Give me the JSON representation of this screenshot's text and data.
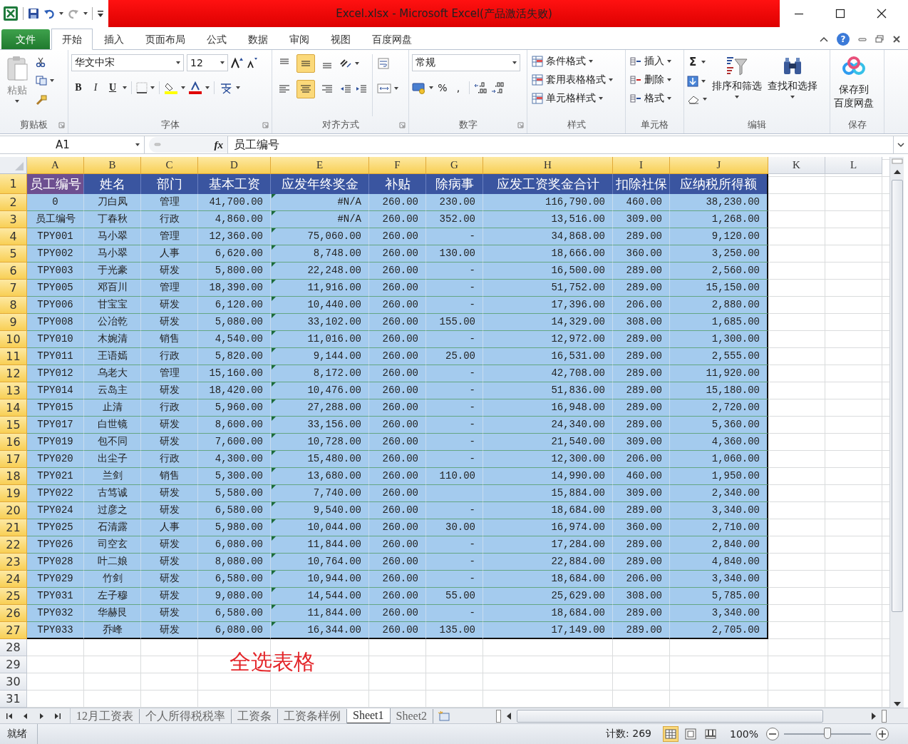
{
  "title_bar": {
    "title": "Excel.xlsx - Microsoft Excel(产品激活失败)"
  },
  "ribbon_tabs": [
    {
      "label": "文件",
      "kind": "file",
      "selected": false
    },
    {
      "label": "开始",
      "kind": "tab",
      "selected": true
    },
    {
      "label": "插入",
      "kind": "tab",
      "selected": false
    },
    {
      "label": "页面布局",
      "kind": "tab",
      "selected": false
    },
    {
      "label": "公式",
      "kind": "tab",
      "selected": false
    },
    {
      "label": "数据",
      "kind": "tab",
      "selected": false
    },
    {
      "label": "审阅",
      "kind": "tab",
      "selected": false
    },
    {
      "label": "视图",
      "kind": "tab",
      "selected": false
    },
    {
      "label": "百度网盘",
      "kind": "tab",
      "selected": false
    }
  ],
  "ribbon": {
    "clipboard": {
      "label": "剪贴板",
      "paste": "粘贴"
    },
    "font": {
      "label": "字体",
      "font_name": "华文中宋",
      "font_size": "12",
      "bold": "B",
      "italic": "I",
      "underline": "U"
    },
    "alignment": {
      "label": "对齐方式",
      "vertical": [
        {
          "selected": false
        },
        {
          "selected": true
        },
        {
          "selected": false
        }
      ],
      "horizontal": [
        {
          "selected": false
        },
        {
          "selected": true
        },
        {
          "selected": false
        }
      ]
    },
    "number": {
      "label": "数字",
      "format": "常规",
      "percent": "%",
      "comma": ","
    },
    "styles": {
      "label": "样式",
      "items": [
        "条件格式",
        "套用表格格式",
        "单元格样式"
      ]
    },
    "cells": {
      "label": "单元格",
      "items": [
        "插入",
        "删除",
        "格式"
      ]
    },
    "editing": {
      "label": "编辑",
      "sum": "Σ",
      "items": [
        "排序和筛选",
        "查找和选择"
      ]
    },
    "save": {
      "label": "保存",
      "button_lines": [
        "保存到",
        "百度网盘"
      ]
    }
  },
  "help": "?",
  "formula_bar": {
    "name_box": "A1",
    "function_label": "fx",
    "content": "员工编号"
  },
  "sheet": {
    "columns": [
      {
        "letter": "A",
        "selected": true
      },
      {
        "letter": "B",
        "selected": true
      },
      {
        "letter": "C",
        "selected": true
      },
      {
        "letter": "D",
        "selected": true
      },
      {
        "letter": "E",
        "selected": true
      },
      {
        "letter": "F",
        "selected": true
      },
      {
        "letter": "G",
        "selected": true
      },
      {
        "letter": "H",
        "selected": true
      },
      {
        "letter": "I",
        "selected": true
      },
      {
        "letter": "J",
        "selected": true
      },
      {
        "letter": "K",
        "selected": false
      },
      {
        "letter": "L",
        "selected": false
      }
    ],
    "rows": [
      {
        "number": "1",
        "selected": true,
        "kind": "header",
        "cells": [
          {
            "text": "员工编号",
            "active": true
          },
          {
            "text": "姓名",
            "active": false
          },
          {
            "text": "部门",
            "active": false
          },
          {
            "text": "基本工资",
            "active": false
          },
          {
            "text": "应发年终奖金",
            "active": false
          },
          {
            "text": "补贴",
            "active": false
          },
          {
            "text": "除病事",
            "active": false
          },
          {
            "text": "应发工资奖金合计",
            "active": false
          },
          {
            "text": "扣除社保",
            "active": false
          },
          {
            "text": "应纳税所得额",
            "active": false
          }
        ]
      },
      {
        "number": "2",
        "selected": true,
        "kind": "data",
        "error_indicator": true,
        "cells": [
          "0",
          "刀白凤",
          "管理",
          "41,700.00",
          "#N/A",
          "260.00",
          "230.00",
          "116,790.00",
          "460.00",
          "38,230.00"
        ]
      },
      {
        "number": "3",
        "selected": true,
        "kind": "data",
        "error_indicator": true,
        "cells": [
          "员工编号",
          "丁春秋",
          "行政",
          "4,860.00",
          "#N/A",
          "260.00",
          "352.00",
          "13,516.00",
          "309.00",
          "1,268.00"
        ]
      },
      {
        "number": "4",
        "selected": true,
        "kind": "data",
        "error_indicator": true,
        "cells": [
          "TPY001",
          "马小翠",
          "管理",
          "12,360.00",
          "75,060.00",
          "260.00",
          "-",
          "34,868.00",
          "289.00",
          "9,120.00"
        ]
      },
      {
        "number": "5",
        "selected": true,
        "kind": "data",
        "error_indicator": true,
        "cells": [
          "TPY002",
          "马小翠",
          "人事",
          "6,620.00",
          "8,748.00",
          "260.00",
          "130.00",
          "18,666.00",
          "360.00",
          "3,250.00"
        ]
      },
      {
        "number": "6",
        "selected": true,
        "kind": "data",
        "error_indicator": true,
        "cells": [
          "TPY003",
          "于光豪",
          "研发",
          "5,800.00",
          "22,248.00",
          "260.00",
          "-",
          "16,500.00",
          "289.00",
          "2,560.00"
        ]
      },
      {
        "number": "7",
        "selected": true,
        "kind": "data",
        "error_indicator": true,
        "cells": [
          "TPY005",
          "邓百川",
          "管理",
          "18,390.00",
          "11,916.00",
          "260.00",
          "-",
          "51,752.00",
          "289.00",
          "15,150.00"
        ]
      },
      {
        "number": "8",
        "selected": true,
        "kind": "data",
        "error_indicator": true,
        "cells": [
          "TPY006",
          "甘宝宝",
          "研发",
          "6,120.00",
          "10,440.00",
          "260.00",
          "-",
          "17,396.00",
          "206.00",
          "2,880.00"
        ]
      },
      {
        "number": "9",
        "selected": true,
        "kind": "data",
        "error_indicator": true,
        "cells": [
          "TPY008",
          "公冶乾",
          "研发",
          "5,080.00",
          "33,102.00",
          "260.00",
          "155.00",
          "14,329.00",
          "308.00",
          "1,685.00"
        ]
      },
      {
        "number": "10",
        "selected": true,
        "kind": "data",
        "error_indicator": true,
        "cells": [
          "TPY010",
          "木婉清",
          "销售",
          "4,540.00",
          "11,016.00",
          "260.00",
          "-",
          "12,972.00",
          "289.00",
          "1,300.00"
        ]
      },
      {
        "number": "11",
        "selected": true,
        "kind": "data",
        "error_indicator": true,
        "cells": [
          "TPY011",
          "王语嫣",
          "行政",
          "5,820.00",
          "9,144.00",
          "260.00",
          "25.00",
          "16,531.00",
          "289.00",
          "2,555.00"
        ]
      },
      {
        "number": "12",
        "selected": true,
        "kind": "data",
        "error_indicator": true,
        "cells": [
          "TPY012",
          "乌老大",
          "管理",
          "15,160.00",
          "8,172.00",
          "260.00",
          "-",
          "42,708.00",
          "289.00",
          "11,920.00"
        ]
      },
      {
        "number": "13",
        "selected": true,
        "kind": "data",
        "error_indicator": true,
        "cells": [
          "TPY014",
          "云岛主",
          "研发",
          "18,420.00",
          "10,476.00",
          "260.00",
          "-",
          "51,836.00",
          "289.00",
          "15,180.00"
        ]
      },
      {
        "number": "14",
        "selected": true,
        "kind": "data",
        "error_indicator": true,
        "cells": [
          "TPY015",
          "止清",
          "行政",
          "5,960.00",
          "27,288.00",
          "260.00",
          "-",
          "16,948.00",
          "289.00",
          "2,720.00"
        ]
      },
      {
        "number": "15",
        "selected": true,
        "kind": "data",
        "error_indicator": true,
        "cells": [
          "TPY017",
          "白世镜",
          "研发",
          "8,600.00",
          "33,156.00",
          "260.00",
          "-",
          "24,340.00",
          "289.00",
          "5,360.00"
        ]
      },
      {
        "number": "16",
        "selected": true,
        "kind": "data",
        "error_indicator": true,
        "cells": [
          "TPY019",
          "包不同",
          "研发",
          "7,600.00",
          "10,728.00",
          "260.00",
          "-",
          "21,540.00",
          "309.00",
          "4,360.00"
        ]
      },
      {
        "number": "17",
        "selected": true,
        "kind": "data",
        "error_indicator": true,
        "cells": [
          "TPY020",
          "出尘子",
          "行政",
          "4,300.00",
          "15,480.00",
          "260.00",
          "-",
          "12,300.00",
          "206.00",
          "1,060.00"
        ]
      },
      {
        "number": "18",
        "selected": true,
        "kind": "data",
        "error_indicator": true,
        "cells": [
          "TPY021",
          "兰剑",
          "销售",
          "5,300.00",
          "13,680.00",
          "260.00",
          "110.00",
          "14,990.00",
          "460.00",
          "1,950.00"
        ]
      },
      {
        "number": "19",
        "selected": true,
        "kind": "data",
        "error_indicator": true,
        "cells": [
          "TPY022",
          "古笃诚",
          "研发",
          "5,580.00",
          "7,740.00",
          "260.00",
          null,
          "15,884.00",
          "309.00",
          "2,340.00"
        ]
      },
      {
        "number": "20",
        "selected": true,
        "kind": "data",
        "error_indicator": true,
        "cells": [
          "TPY024",
          "过彦之",
          "研发",
          "6,580.00",
          "9,540.00",
          "260.00",
          "-",
          "18,684.00",
          "289.00",
          "3,340.00"
        ]
      },
      {
        "number": "21",
        "selected": true,
        "kind": "data",
        "error_indicator": true,
        "cells": [
          "TPY025",
          "石清露",
          "人事",
          "5,980.00",
          "10,044.00",
          "260.00",
          "30.00",
          "16,974.00",
          "360.00",
          "2,710.00"
        ]
      },
      {
        "number": "22",
        "selected": true,
        "kind": "data",
        "error_indicator": true,
        "cells": [
          "TPY026",
          "司空玄",
          "研发",
          "6,080.00",
          "11,844.00",
          "260.00",
          "-",
          "17,284.00",
          "289.00",
          "2,840.00"
        ]
      },
      {
        "number": "23",
        "selected": true,
        "kind": "data",
        "error_indicator": true,
        "cells": [
          "TPY028",
          "叶二娘",
          "研发",
          "8,080.00",
          "10,764.00",
          "260.00",
          "-",
          "22,884.00",
          "289.00",
          "4,840.00"
        ]
      },
      {
        "number": "24",
        "selected": true,
        "kind": "data",
        "error_indicator": true,
        "cells": [
          "TPY029",
          "竹剑",
          "研发",
          "6,580.00",
          "10,944.00",
          "260.00",
          "-",
          "18,684.00",
          "206.00",
          "3,340.00"
        ]
      },
      {
        "number": "25",
        "selected": true,
        "kind": "data",
        "error_indicator": true,
        "cells": [
          "TPY031",
          "左子穆",
          "研发",
          "9,080.00",
          "14,544.00",
          "260.00",
          "55.00",
          "25,629.00",
          "308.00",
          "5,785.00"
        ]
      },
      {
        "number": "26",
        "selected": true,
        "kind": "data",
        "error_indicator": true,
        "cells": [
          "TPY032",
          "华赫艮",
          "研发",
          "6,580.00",
          "11,844.00",
          "260.00",
          "-",
          "18,684.00",
          "289.00",
          "3,340.00"
        ]
      },
      {
        "number": "27",
        "selected": true,
        "kind": "data",
        "error_indicator": true,
        "cells": [
          "TPY033",
          "乔峰",
          "研发",
          "6,080.00",
          "16,344.00",
          "260.00",
          "135.00",
          "17,149.00",
          "289.00",
          "2,705.00"
        ]
      },
      {
        "number": "28",
        "selected": false,
        "kind": "empty"
      },
      {
        "number": "29",
        "selected": false,
        "kind": "empty"
      },
      {
        "number": "30",
        "selected": false,
        "kind": "empty"
      },
      {
        "number": "31",
        "selected": false,
        "kind": "empty"
      }
    ],
    "annotation": "全选表格"
  },
  "sheet_tabs": [
    {
      "label": "12月工资表",
      "selected": false
    },
    {
      "label": "个人所得税税率",
      "selected": false
    },
    {
      "label": "工资条",
      "selected": false
    },
    {
      "label": "工资条样例",
      "selected": false
    },
    {
      "label": "Sheet1",
      "selected": true
    },
    {
      "label": "Sheet2",
      "selected": false
    }
  ],
  "status_bar": {
    "status": "就绪",
    "count": "计数: 269",
    "views": [
      {
        "selected": true
      },
      {
        "selected": false
      },
      {
        "selected": false
      }
    ],
    "zoom": {
      "label": "100%",
      "level": 0.5
    }
  }
}
